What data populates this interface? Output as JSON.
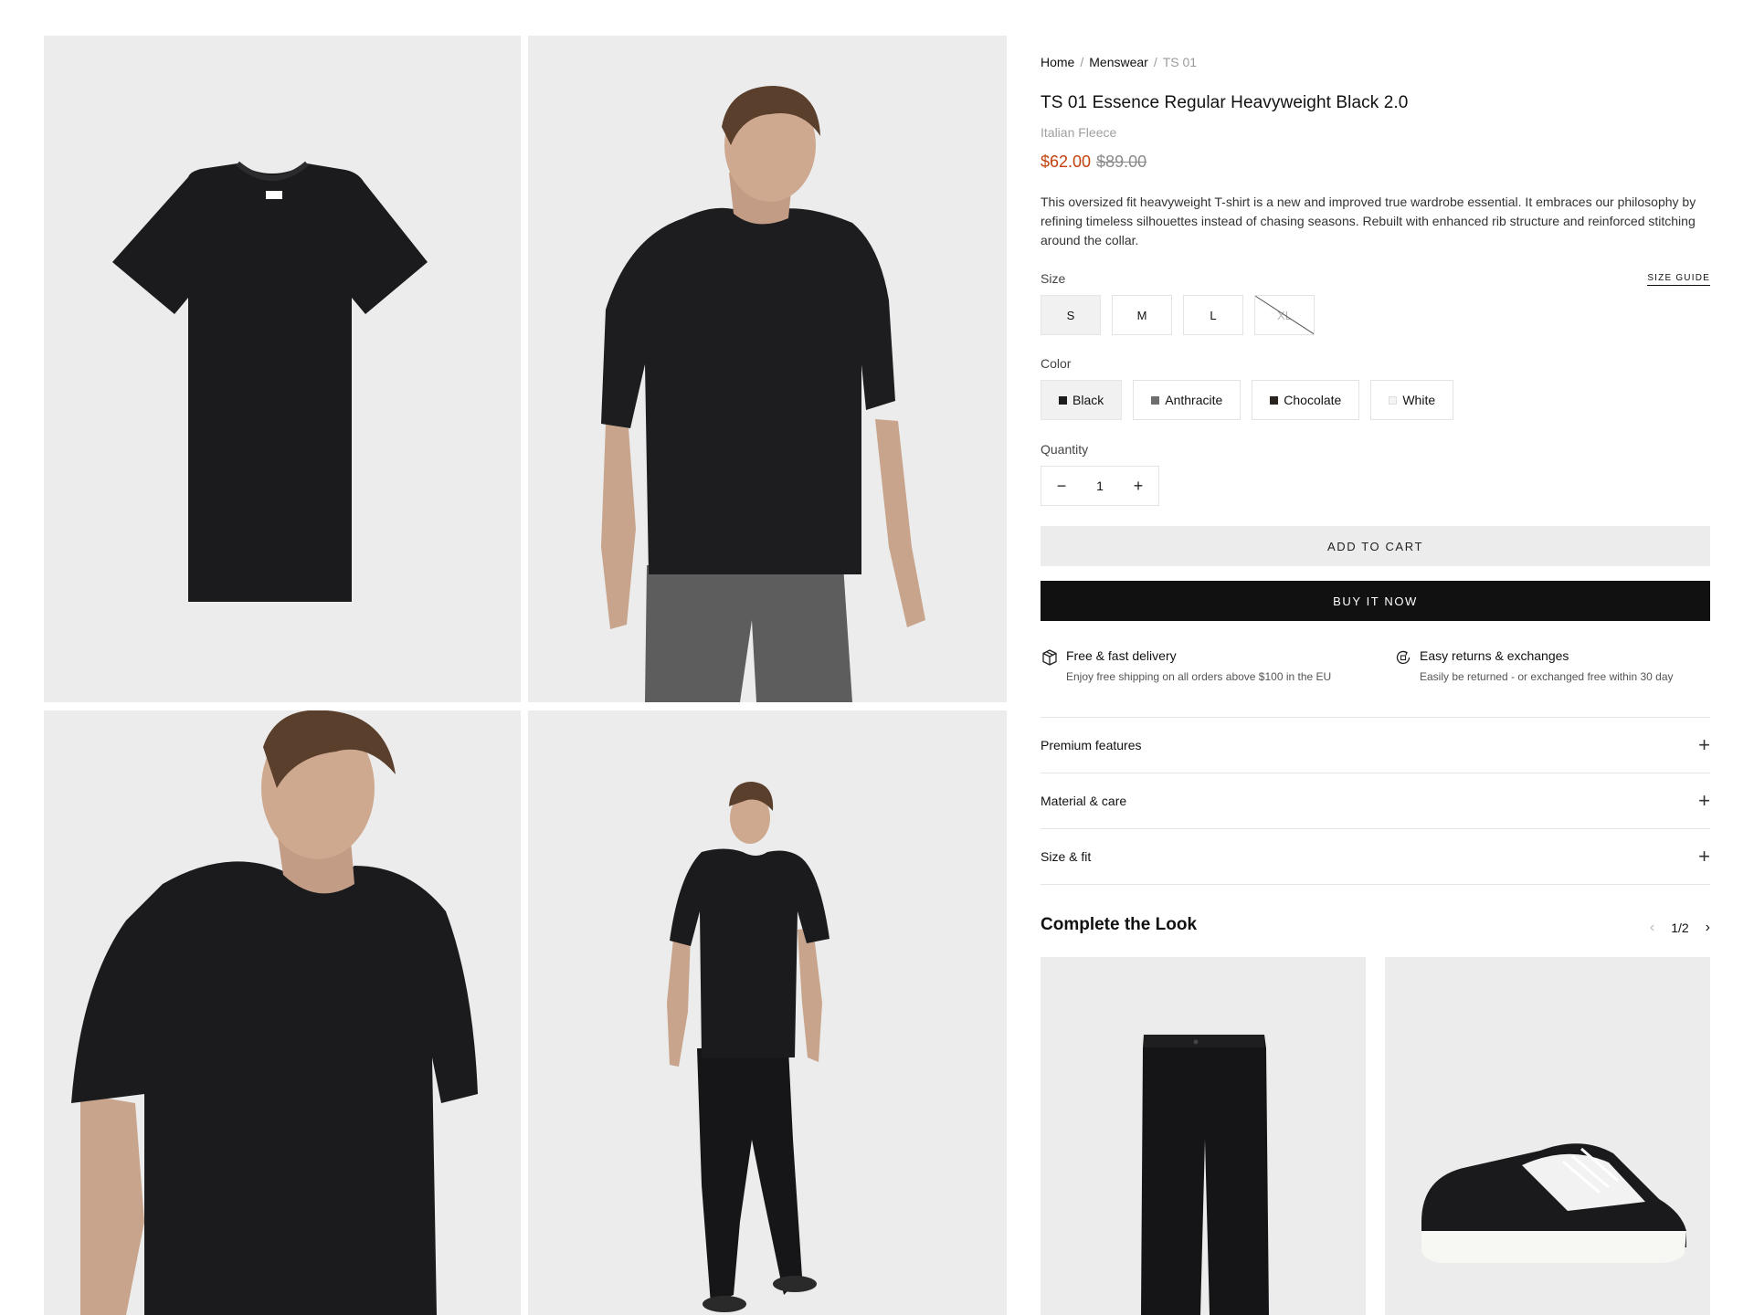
{
  "breadcrumb": {
    "home": "Home",
    "category": "Menswear",
    "current": "TS 01",
    "separator": "/"
  },
  "product": {
    "title": "TS 01 Essence Regular Heavyweight Black 2.0",
    "subtitle": "Italian Fleece",
    "price_sale": "$62.00",
    "price_original": "$89.00",
    "description": "This oversized fit heavyweight T-shirt is a new and improved true wardrobe essential. It embraces our philosophy by refining timeless silhouettes instead of chasing seasons. Rebuilt with enhanced rib structure and reinforced stitching around the collar."
  },
  "size": {
    "label": "Size",
    "guide": "SIZE GUIDE",
    "options": [
      {
        "label": "S",
        "selected": true,
        "available": true
      },
      {
        "label": "M",
        "selected": false,
        "available": true
      },
      {
        "label": "L",
        "selected": false,
        "available": true
      },
      {
        "label": "XL",
        "selected": false,
        "available": false
      }
    ]
  },
  "color": {
    "label": "Color",
    "options": [
      {
        "label": "Black",
        "swatch": "#1c1c1c",
        "selected": true
      },
      {
        "label": "Anthracite",
        "swatch": "#6e6e6e",
        "selected": false
      },
      {
        "label": "Chocolate",
        "swatch": "#2a2420",
        "selected": false
      },
      {
        "label": "White",
        "swatch": "#f4f4f4",
        "selected": false
      }
    ]
  },
  "quantity": {
    "label": "Quantity",
    "value": "1",
    "minus": "−",
    "plus": "+"
  },
  "actions": {
    "add_to_cart": "ADD TO CART",
    "buy_now": "BUY IT NOW"
  },
  "perks": [
    {
      "icon": "box-icon",
      "title": "Free & fast delivery",
      "subtitle": "Enjoy free shipping on all orders above $100 in the EU"
    },
    {
      "icon": "return-icon",
      "title": "Easy returns & exchanges",
      "subtitle": "Easily be returned - or exchanged free within 30 day"
    }
  ],
  "accordion": [
    {
      "label": "Premium features",
      "icon": "plus-icon"
    },
    {
      "label": "Material & care",
      "icon": "plus-icon"
    },
    {
      "label": "Size & fit",
      "icon": "plus-icon"
    }
  ],
  "complete_look": {
    "title": "Complete the Look",
    "page": "1/2"
  },
  "gallery": [
    {
      "name": "tshirt-flat-image"
    },
    {
      "name": "model-front-image"
    },
    {
      "name": "model-closeup-image"
    },
    {
      "name": "model-full-body-image"
    }
  ],
  "colors": {
    "sale_price": "#c2410c",
    "buy_now_bg": "#111111",
    "add_cart_bg": "#ececec",
    "image_bg": "#ececec"
  }
}
